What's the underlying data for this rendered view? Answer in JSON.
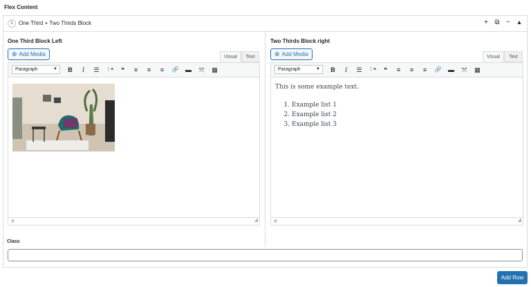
{
  "flex": {
    "title": "Flex Content",
    "row_number": "1",
    "row_label": "One Third + Two Thirds Block",
    "actions": [
      "+",
      "⧉",
      "−",
      "▴"
    ]
  },
  "left": {
    "title": "One Third Block Left",
    "add_media": "Add Media",
    "tab_visual": "Visual",
    "tab_text": "Text",
    "format": "Paragraph",
    "status": "p"
  },
  "right": {
    "title": "Two Thirds Block right",
    "add_media": "Add Media",
    "tab_visual": "Visual",
    "tab_text": "Text",
    "format": "Paragraph",
    "status": "p",
    "paragraph": "This is some example text.",
    "list": [
      "Example list 1",
      "Example list 2",
      "Example list 3"
    ]
  },
  "toolbar_icons": [
    "B",
    "I",
    "☰",
    "⋮≡",
    "❝",
    "≡",
    "≡",
    "≡",
    "🔗",
    "▬",
    "⤧",
    "▦"
  ],
  "class_field": {
    "label": "Class",
    "value": ""
  },
  "add_row": "Add Row",
  "colors": {
    "primary": "#2271b1",
    "border": "#dcdcde"
  }
}
